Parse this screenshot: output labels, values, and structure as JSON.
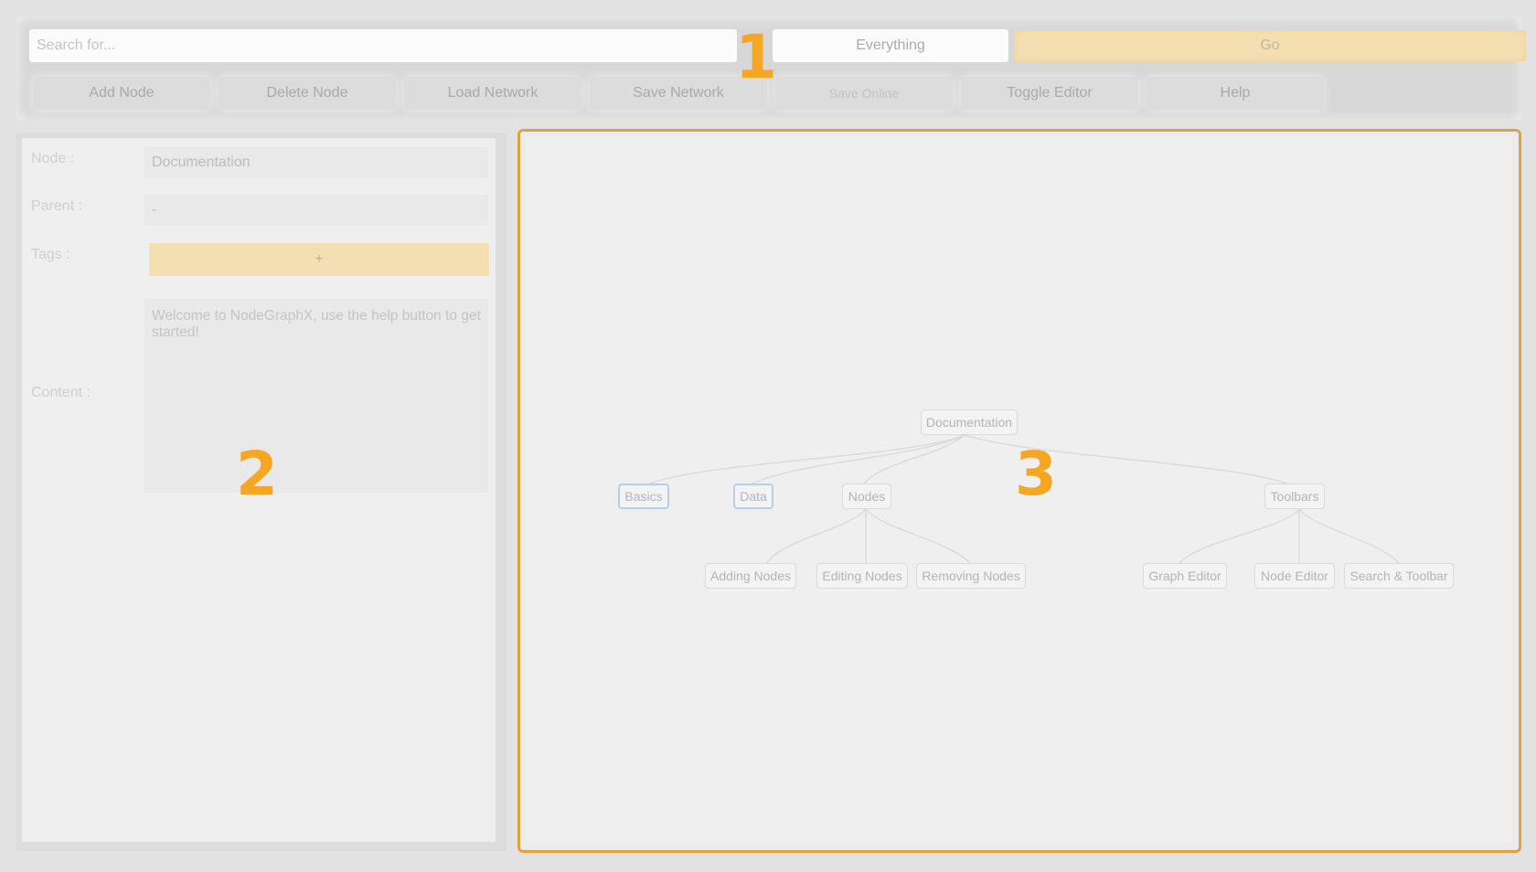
{
  "toolbar": {
    "search_placeholder": "Search for...",
    "scope": "Everything",
    "go_label": "Go",
    "buttons": [
      "Add Node",
      "Delete Node",
      "Load Network",
      "Save Network",
      "Save Online",
      "Toggle Editor",
      "Help"
    ]
  },
  "editor": {
    "node_label": "Node :",
    "node_value": "Documentation",
    "parent_label": "Parent :",
    "parent_value": "-",
    "tags_label": "Tags :",
    "tags_add": "+",
    "content_label": "Content :",
    "content_value": "Welcome to NodeGraphX, use the help button to get started!"
  },
  "graph": {
    "nodes": [
      "Documentation",
      "Basics",
      "Data",
      "Nodes",
      "Toolbars",
      "Adding Nodes",
      "Editing Nodes",
      "Removing Nodes",
      "Graph Editor",
      "Node Editor",
      "Search & Toolbar"
    ]
  },
  "callouts": [
    "1",
    "2",
    "3"
  ],
  "colors": {
    "accent": "#f5a623",
    "go": "#f3dfb2",
    "graph_border": "#e0a23a",
    "selected_node_border": "#b6d0e8"
  }
}
